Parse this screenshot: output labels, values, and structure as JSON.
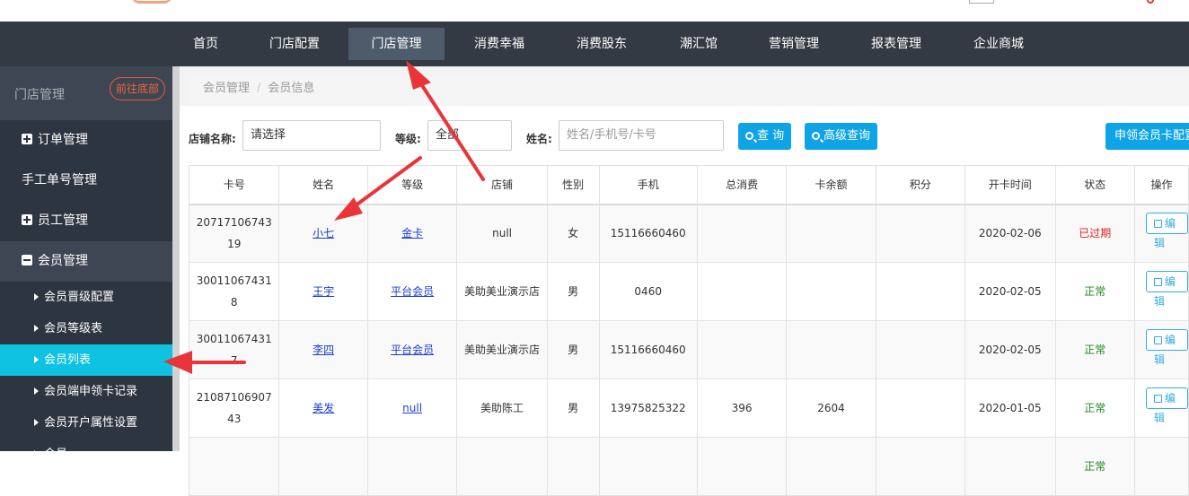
{
  "nav": {
    "items": [
      {
        "label": "首页"
      },
      {
        "label": "门店配置"
      },
      {
        "label": "门店管理",
        "active": true
      },
      {
        "label": "消费幸福"
      },
      {
        "label": "消费股东"
      },
      {
        "label": "潮汇馆"
      },
      {
        "label": "营销管理"
      },
      {
        "label": "报表管理"
      },
      {
        "label": "企业商城"
      }
    ]
  },
  "sidebar": {
    "title": "门店管理",
    "bottom_button": "前往底部",
    "items": [
      {
        "label": "订单管理"
      },
      {
        "label": "手工单号管理"
      },
      {
        "label": "员工管理"
      },
      {
        "label": "会员管理"
      }
    ],
    "subitems": [
      {
        "label": "会员晋级配置"
      },
      {
        "label": "会员等级表"
      },
      {
        "label": "会员列表"
      },
      {
        "label": "会员端申领卡记录"
      },
      {
        "label": "会员开户属性设置"
      },
      {
        "label": "会员..."
      }
    ]
  },
  "breadcrumb": {
    "root": "会员管理",
    "sep": "/",
    "current": "会员信息"
  },
  "filters": {
    "store_label": "店铺名称:",
    "store_value": "请选择",
    "level_label": "等级:",
    "level_value": "全部",
    "name_label": "姓名:",
    "name_placeholder": "姓名/手机号/卡号",
    "query_button": "查 询",
    "advanced_button": "高级查询",
    "apply_card_button": "申领会员卡配置"
  },
  "table": {
    "headers": [
      "卡号",
      "姓名",
      "等级",
      "店铺",
      "性别",
      "手机",
      "总消费",
      "卡余额",
      "积分",
      "开卡时间",
      "状态",
      "操作"
    ],
    "edit_label": "编辑",
    "rows": [
      {
        "card": "2071710674319",
        "name": "小七",
        "level": "金卡",
        "store": "null",
        "gender": "女",
        "phone": "15116660460",
        "total": "",
        "balance": "",
        "points": "",
        "open_date": "2020-02-06",
        "status": "已过期"
      },
      {
        "card": "300110674318",
        "name": "王宇",
        "level": "平台会员",
        "store": "美助美业演示店",
        "gender": "男",
        "phone": "0460",
        "total": "",
        "balance": "",
        "points": "",
        "open_date": "2020-02-05",
        "status": "正常"
      },
      {
        "card": "300110674317",
        "name": "李四",
        "level": "平台会员",
        "store": "美助美业演示店",
        "gender": "男",
        "phone": "15116660460",
        "total": "",
        "balance": "",
        "points": "",
        "open_date": "2020-02-05",
        "status": "正常"
      },
      {
        "card": "2108710690743",
        "name": "美发",
        "level": "null",
        "store": "美助陈工",
        "gender": "男",
        "phone": "13975825322",
        "total": "396",
        "balance": "2604",
        "points": "",
        "open_date": "2020-01-05",
        "status": "正常"
      },
      {
        "card": "",
        "name": "",
        "level": "",
        "store": "",
        "gender": "",
        "phone": "",
        "total": "",
        "balance": "",
        "points": "",
        "open_date": "",
        "status": "正常"
      }
    ]
  },
  "colors": {
    "navbar": "#333a43",
    "sidebar": "#2d3540",
    "active_sub": "#0fc2e1",
    "button": "#0ea4e6",
    "arrow": "#e8353a"
  }
}
